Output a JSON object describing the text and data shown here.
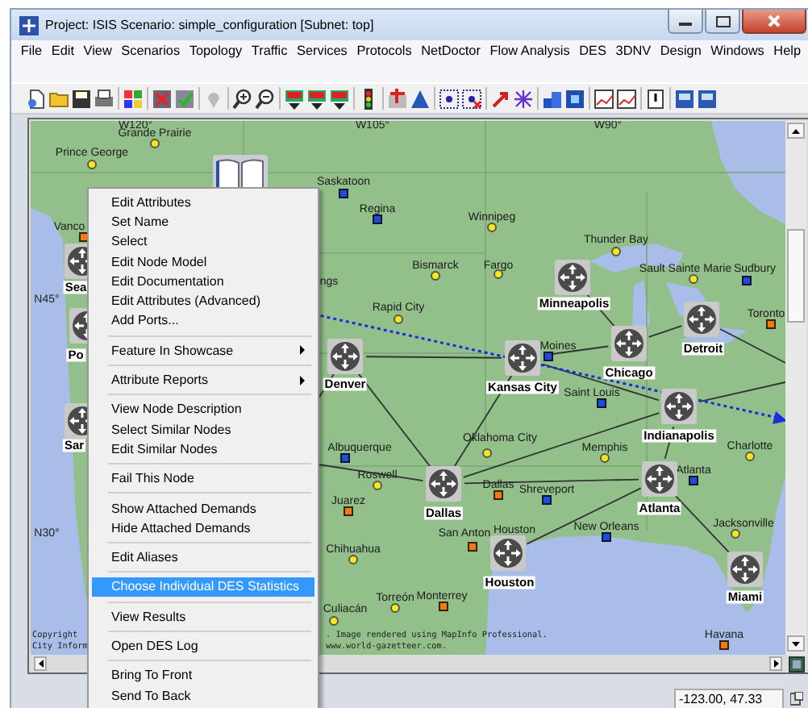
{
  "window": {
    "title": "Project: ISIS Scenario: simple_configuration  [Subnet: top]"
  },
  "menu": [
    "File",
    "Edit",
    "View",
    "Scenarios",
    "Topology",
    "Traffic",
    "Services",
    "Protocols",
    "NetDoctor",
    "Flow Analysis",
    "DES",
    "3DNV",
    "Design",
    "Windows",
    "Help"
  ],
  "map": {
    "grid_labels": [
      "W120°",
      "W105°",
      "W90°",
      "N45°",
      "N30°"
    ],
    "cities": [
      {
        "name": "Grande Prairie",
        "kind": "dot"
      },
      {
        "name": "Prince George",
        "kind": "dot"
      },
      {
        "name": "Vanco",
        "kind": "capital"
      },
      {
        "name": "Saskatoon",
        "kind": "square"
      },
      {
        "name": "Regina",
        "kind": "square"
      },
      {
        "name": "Winnipeg",
        "kind": "dot"
      },
      {
        "name": "Thunder Bay",
        "kind": "dot"
      },
      {
        "name": "Bismarck",
        "kind": "dot"
      },
      {
        "name": "Fargo",
        "kind": "dot"
      },
      {
        "name": "Sault Sainte Marie",
        "kind": "dot"
      },
      {
        "name": "Sudbury",
        "kind": "square"
      },
      {
        "name": "Toronto",
        "kind": "capital"
      },
      {
        "name": "Rapid City",
        "kind": "dot"
      },
      {
        "name": "ngs",
        "kind": "label"
      },
      {
        "name": "Moines",
        "kind": "square"
      },
      {
        "name": "Saint Louis",
        "kind": "square"
      },
      {
        "name": "Albuquerque",
        "kind": "square"
      },
      {
        "name": "Roswell",
        "kind": "dot"
      },
      {
        "name": "Oklahoma City",
        "kind": "dot"
      },
      {
        "name": "Memphis",
        "kind": "dot"
      },
      {
        "name": "Charlotte",
        "kind": "dot"
      },
      {
        "name": "Dallas",
        "kind": "capital"
      },
      {
        "name": "Shreveport",
        "kind": "square"
      },
      {
        "name": "Juarez",
        "kind": "capital"
      },
      {
        "name": "Chihuahua",
        "kind": "dot"
      },
      {
        "name": "San Anton",
        "kind": "capital"
      },
      {
        "name": "Houston",
        "kind": "label"
      },
      {
        "name": "New Orleans",
        "kind": "square"
      },
      {
        "name": "Jacksonville",
        "kind": "dot"
      },
      {
        "name": "Atlanta",
        "kind": "square"
      },
      {
        "name": "Havana",
        "kind": "capital"
      },
      {
        "name": "Torreón",
        "kind": "dot"
      },
      {
        "name": "Monterrey",
        "kind": "capital"
      },
      {
        "name": "Culiacán",
        "kind": "dot"
      }
    ],
    "nodes": [
      {
        "name": "Sea"
      },
      {
        "name": "Po"
      },
      {
        "name": "Sar"
      },
      {
        "name": "Denver"
      },
      {
        "name": "Kansas City"
      },
      {
        "name": "Minneapolis"
      },
      {
        "name": "Chicago"
      },
      {
        "name": "Detroit"
      },
      {
        "name": "Indianapolis"
      },
      {
        "name": "Dallas"
      },
      {
        "name": "Atlanta"
      },
      {
        "name": "Houston"
      },
      {
        "name": "Miami"
      }
    ],
    "copyright": [
      {
        "left": "Copyright",
        "right": ". Image rendered using MapInfo Professional."
      },
      {
        "left": "City Inform",
        "right": "www.world-gazetteer.com."
      }
    ]
  },
  "context_menu": {
    "items": [
      {
        "kind": "item",
        "label": "Edit Attributes",
        "selected": false,
        "submenu": false
      },
      {
        "kind": "item",
        "label": "Set Name",
        "selected": false,
        "submenu": false
      },
      {
        "kind": "item",
        "label": "Select",
        "selected": false,
        "submenu": false
      },
      {
        "kind": "item",
        "label": "Edit Node Model",
        "selected": false,
        "submenu": false
      },
      {
        "kind": "item",
        "label": "Edit Documentation",
        "selected": false,
        "submenu": false
      },
      {
        "kind": "item",
        "label": "Edit Attributes (Advanced)",
        "selected": false,
        "submenu": false
      },
      {
        "kind": "item",
        "label": "Add Ports...",
        "selected": false,
        "submenu": false
      },
      {
        "kind": "separator"
      },
      {
        "kind": "item",
        "label": "Feature In Showcase",
        "selected": false,
        "submenu": true
      },
      {
        "kind": "separator"
      },
      {
        "kind": "item",
        "label": "Attribute Reports",
        "selected": false,
        "submenu": true
      },
      {
        "kind": "separator"
      },
      {
        "kind": "item",
        "label": "View Node Description",
        "selected": false,
        "submenu": false
      },
      {
        "kind": "item",
        "label": "Select Similar Nodes",
        "selected": false,
        "submenu": false
      },
      {
        "kind": "item",
        "label": "Edit Similar Nodes",
        "selected": false,
        "submenu": false
      },
      {
        "kind": "separator"
      },
      {
        "kind": "item",
        "label": "Fail This Node",
        "selected": false,
        "submenu": false
      },
      {
        "kind": "separator"
      },
      {
        "kind": "item",
        "label": "Show Attached Demands",
        "selected": false,
        "submenu": false
      },
      {
        "kind": "item",
        "label": "Hide Attached Demands",
        "selected": false,
        "submenu": false
      },
      {
        "kind": "separator"
      },
      {
        "kind": "item",
        "label": "Edit Aliases",
        "selected": false,
        "submenu": false
      },
      {
        "kind": "separator"
      },
      {
        "kind": "item",
        "label": "Choose Individual DES Statistics",
        "selected": true,
        "submenu": false
      },
      {
        "kind": "separator"
      },
      {
        "kind": "item",
        "label": "View Results",
        "selected": false,
        "submenu": false
      },
      {
        "kind": "separator"
      },
      {
        "kind": "item",
        "label": "Open DES Log",
        "selected": false,
        "submenu": false
      },
      {
        "kind": "separator"
      },
      {
        "kind": "item",
        "label": "Bring To Front",
        "selected": false,
        "submenu": false
      },
      {
        "kind": "item",
        "label": "Send To Back",
        "selected": false,
        "submenu": false
      }
    ]
  },
  "status_bar": {
    "coordinates": "-123.00, 47.33"
  }
}
